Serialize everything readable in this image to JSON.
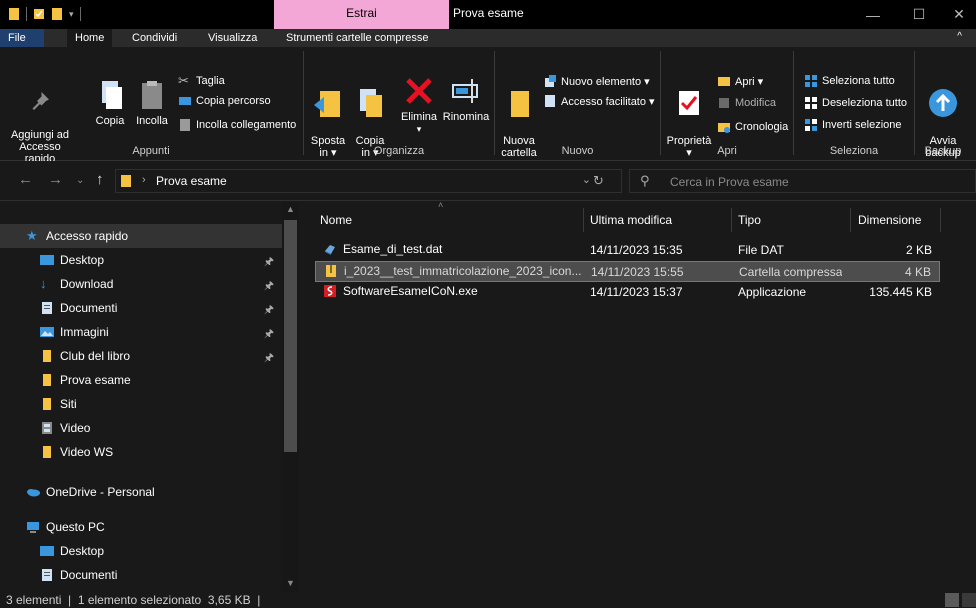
{
  "window": {
    "context_tab": "Estrai",
    "title": "Prova esame"
  },
  "tabs": {
    "file": "File",
    "home": "Home",
    "condividi": "Condividi",
    "visualizza": "Visualizza",
    "strumenti": "Strumenti cartelle compresse"
  },
  "ribbon": {
    "appunti": {
      "label": "Appunti",
      "aggiungi": "Aggiungi ad\nAccesso rapido",
      "copia": "Copia",
      "incolla": "Incolla",
      "taglia": "Taglia",
      "copia_percorso": "Copia percorso",
      "incolla_collegamento": "Incolla collegamento"
    },
    "organizza": {
      "label": "Organizza",
      "sposta": "Sposta\nin ▾",
      "copia_in": "Copia\nin ▾",
      "elimina": "Elimina",
      "rinomina": "Rinomina"
    },
    "nuovo": {
      "label": "Nuovo",
      "nuova_cartella": "Nuova\ncartella",
      "nuovo_elemento": "Nuovo elemento ▾",
      "accesso_facilitato": "Accesso facilitato ▾"
    },
    "apri": {
      "label": "Apri",
      "proprieta": "Proprietà\n▾",
      "apri": "Apri ▾",
      "modifica": "Modifica",
      "cronologia": "Cronologia"
    },
    "seleziona": {
      "label": "Seleziona",
      "seleziona_tutto": "Seleziona tutto",
      "deseleziona_tutto": "Deseleziona tutto",
      "inverti_selezione": "Inverti selezione"
    },
    "backup": {
      "label": "Backup",
      "avvia_backup": "Avvia\nbackup"
    }
  },
  "address": {
    "path": "Prova esame",
    "search_placeholder": "Cerca in Prova esame"
  },
  "nav_pane": {
    "items": [
      {
        "label": "Accesso rapido",
        "icon": "star-icon",
        "pinned": false
      },
      {
        "label": "Desktop",
        "icon": "desktop-icon",
        "pinned": true
      },
      {
        "label": "Download",
        "icon": "download-icon",
        "pinned": true
      },
      {
        "label": "Documenti",
        "icon": "documents-icon",
        "pinned": true
      },
      {
        "label": "Immagini",
        "icon": "pictures-icon",
        "pinned": true
      },
      {
        "label": "Club del libro",
        "icon": "folder-icon",
        "pinned": true
      },
      {
        "label": "Prova esame",
        "icon": "folder-icon",
        "pinned": false
      },
      {
        "label": "Siti",
        "icon": "folder-icon",
        "pinned": false
      },
      {
        "label": "Video",
        "icon": "video-icon",
        "pinned": false
      },
      {
        "label": "Video WS",
        "icon": "folder-icon",
        "pinned": false
      },
      {
        "label": "OneDrive - Personal",
        "icon": "onedrive-icon",
        "pinned": false
      },
      {
        "label": "Questo PC",
        "icon": "pc-icon",
        "pinned": false
      },
      {
        "label": "Desktop",
        "icon": "desktop-icon",
        "pinned": false
      },
      {
        "label": "Documenti",
        "icon": "documents-icon",
        "pinned": false
      }
    ]
  },
  "file_list": {
    "columns": {
      "name": "Nome",
      "modified": "Ultima modifica",
      "type": "Tipo",
      "size": "Dimensione"
    },
    "rows": [
      {
        "name": "Esame_di_test.dat",
        "modified": "14/11/2023 15:35",
        "type": "File DAT",
        "size": "2 KB",
        "icon": "dat-file-icon",
        "selected": false
      },
      {
        "name": "i_2023__test_immatricolazione_2023_icon...",
        "modified": "14/11/2023 15:55",
        "type": "Cartella compressa",
        "size": "4 KB",
        "icon": "zip-folder-icon",
        "selected": true
      },
      {
        "name": "SoftwareEsameICoN.exe",
        "modified": "14/11/2023 15:37",
        "type": "Applicazione",
        "size": "135.445 KB",
        "icon": "exe-file-icon",
        "selected": false
      }
    ]
  },
  "status": {
    "text": "3 elementi  |  1 elemento selezionato  3,65 KB  |"
  },
  "colors": {
    "background": "#191919",
    "context_tab": "#f3a7d6",
    "selection": "#4d4d4d",
    "folder": "#f5c242",
    "accent_blue": "#3a96dd"
  }
}
